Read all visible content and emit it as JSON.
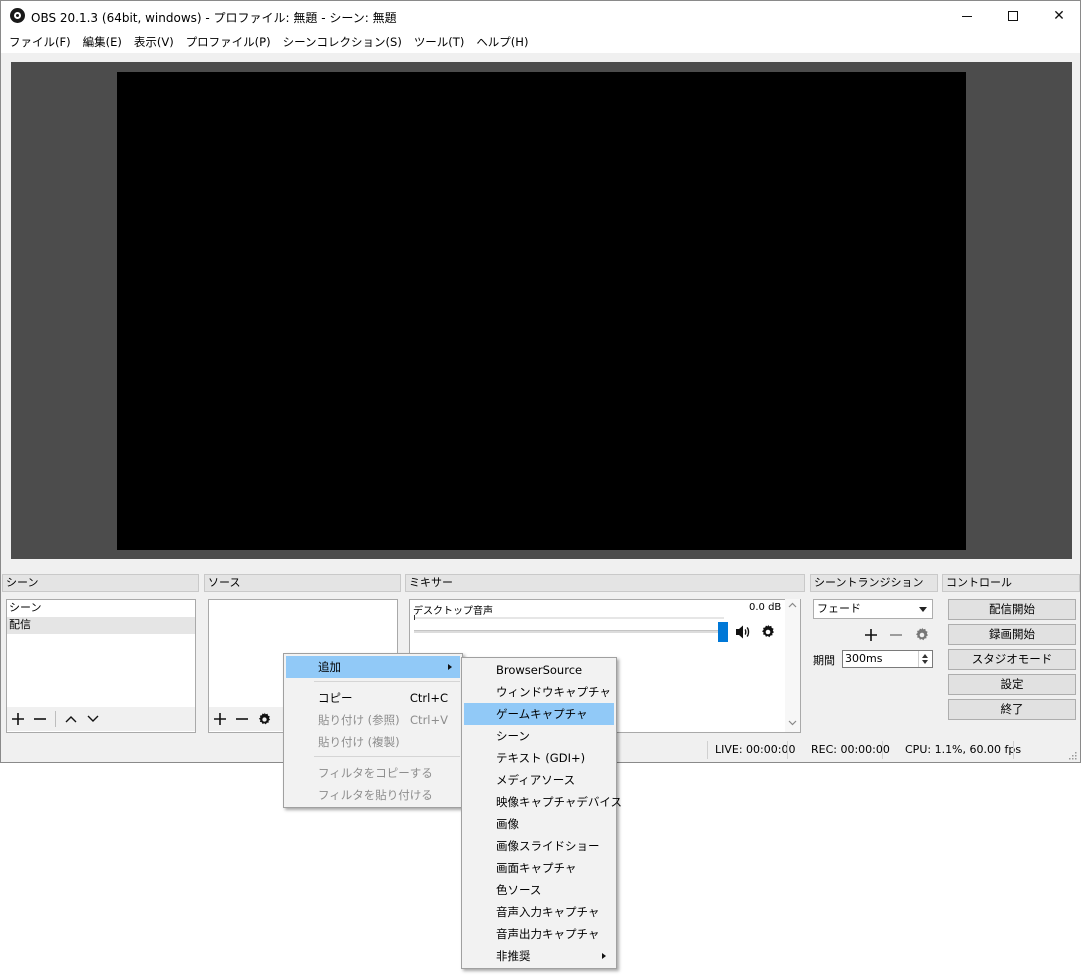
{
  "window": {
    "title": "OBS 20.1.3 (64bit, windows) - プロファイル: 無題 - シーン: 無題",
    "controls": {
      "close": "✕"
    }
  },
  "menu": [
    "ファイル(F)",
    "編集(E)",
    "表示(V)",
    "プロファイル(P)",
    "シーンコレクション(S)",
    "ツール(T)",
    "ヘルプ(H)"
  ],
  "docks": {
    "scenes": {
      "header": "シーン",
      "items": [
        "シーン",
        "配信"
      ],
      "selected_index": 1
    },
    "sources": {
      "header": "ソース"
    },
    "mixer": {
      "header": "ミキサー",
      "track_name": "デスクトップ音声",
      "db_value": "0.0 dB"
    },
    "transitions": {
      "header": "シーントランジション",
      "selected": "フェード",
      "duration_label": "期間",
      "duration_value": "300ms"
    },
    "controls": {
      "header": "コントロール",
      "buttons": [
        "配信開始",
        "録画開始",
        "スタジオモード",
        "設定",
        "終了"
      ]
    }
  },
  "status": {
    "live": "LIVE: 00:00:00",
    "rec": "REC: 00:00:00",
    "cpu": "CPU: 1.1%, 60.00 fps"
  },
  "context_menu": {
    "items": [
      {
        "label": "追加",
        "shortcut": "",
        "highlighted": true,
        "disabled": false,
        "has_submenu": true
      },
      {
        "label": "コピー",
        "shortcut": "Ctrl+C",
        "highlighted": false,
        "disabled": false
      },
      {
        "label": "貼り付け (参照)",
        "shortcut": "Ctrl+V",
        "highlighted": false,
        "disabled": true
      },
      {
        "label": "貼り付け (複製)",
        "shortcut": "",
        "highlighted": false,
        "disabled": true
      },
      {
        "label": "フィルタをコピーする",
        "shortcut": "",
        "highlighted": false,
        "disabled": true
      },
      {
        "label": "フィルタを貼り付ける",
        "shortcut": "",
        "highlighted": false,
        "disabled": true
      }
    ]
  },
  "submenu": {
    "items": [
      "BrowserSource",
      "ウィンドウキャプチャ",
      "ゲームキャプチャ",
      "シーン",
      "テキスト (GDI+)",
      "メディアソース",
      "映像キャプチャデバイス",
      "画像",
      "画像スライドショー",
      "画面キャプチャ",
      "色ソース",
      "音声入力キャプチャ",
      "音声出力キャプチャ",
      "非推奨"
    ],
    "highlighted_index": 2,
    "submenu_item": "非推奨"
  },
  "colors": {
    "accent": "#0078d7",
    "menu_highlight": "#91c9f7",
    "preview_bg": "#4c4c4c"
  }
}
